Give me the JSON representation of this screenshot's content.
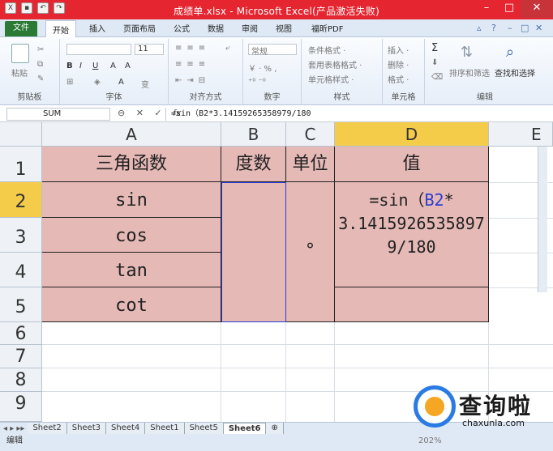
{
  "window": {
    "title": "成绩单.xlsx - Microsoft Excel(产品激活失败)"
  },
  "tabs": [
    {
      "label": "文件"
    },
    {
      "label": "开始"
    },
    {
      "label": "插入"
    },
    {
      "label": "页面布局"
    },
    {
      "label": "公式"
    },
    {
      "label": "数据"
    },
    {
      "label": "审阅"
    },
    {
      "label": "视图"
    },
    {
      "label": "福昕PDF"
    }
  ],
  "ribbon": {
    "paste": "粘贴",
    "font_size": "11",
    "number_format": "常规",
    "groups": {
      "clipboard": "剪贴板",
      "font": "字体",
      "align": "对齐方式",
      "number": "数字",
      "styles": "样式",
      "cells": "单元格",
      "edit": "编辑"
    },
    "styles_items": [
      "条件格式 ·",
      "套用表格格式 ·",
      "单元格样式 ·"
    ],
    "cells_items": [
      "插入 ·",
      "删除 ·",
      "格式 ·"
    ],
    "sort_filter": "排序和筛选",
    "find_select": "查找和选择"
  },
  "formula_bar": {
    "name_box": "SUM",
    "fx": "fx",
    "content": "=sin（B2*3.14159265358979/180"
  },
  "columns": [
    "A",
    "B",
    "C",
    "D"
  ],
  "rows": [
    "1",
    "2",
    "3",
    "4",
    "5",
    "6",
    "7",
    "8",
    "9"
  ],
  "cells": {
    "a1": "三角函数",
    "b1": "度数",
    "c1": "单位",
    "d1": "值",
    "a2": "sin",
    "a3": "cos",
    "a4": "tan",
    "a5": "cot",
    "c2": "°",
    "d2_prefix": "=sin（",
    "d2_ref": "B2",
    "d2_rest": "*",
    "d2_line2": "3.1415926535897",
    "d2_line3": "9/180"
  },
  "sheets": [
    "Sheet2",
    "Sheet3",
    "Sheet4",
    "Sheet1",
    "Sheet5",
    "Sheet6"
  ],
  "status": {
    "mode": "编辑",
    "zoom": "202%"
  },
  "watermark": {
    "brand": "查询啦",
    "url": "chaxunla.com"
  },
  "colors": {
    "title_bar": "#e52630",
    "cell_fill": "#e5b9b6",
    "selected_header": "#f5cb4a",
    "file_tab": "#2a7a35"
  }
}
